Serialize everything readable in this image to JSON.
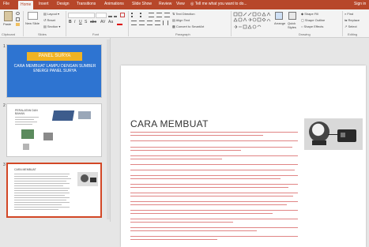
{
  "tabs": [
    "File",
    "Home",
    "Insert",
    "Design",
    "Transitions",
    "Animations",
    "Slide Show",
    "Review",
    "View",
    "Tell me what you want to do..."
  ],
  "user": "Sign in",
  "ribbon": {
    "clipboard": {
      "paste": "Paste",
      "group": "Clipboard"
    },
    "slides": {
      "new_slide": "New Slide",
      "layout": "Layout",
      "reset": "Reset",
      "section": "Section",
      "group": "Slides"
    },
    "font": {
      "group": "Font"
    },
    "paragraph": {
      "text_direction": "Text Direction",
      "align_text": "Align Text",
      "smartart": "Convert to SmartArt",
      "group": "Paragraph"
    },
    "drawing": {
      "arrange": "Arrange",
      "quick_styles": "Quick Styles",
      "shape_fill": "Shape Fill",
      "shape_outline": "Shape Outline",
      "shape_effects": "Shape Effects",
      "group": "Drawing"
    },
    "editing": {
      "find": "Find",
      "replace": "Replace",
      "select": "Select",
      "group": "Editing"
    }
  },
  "thumbs": [
    {
      "num": "1",
      "header": "PANEL SURYA",
      "title": "CARA MEMBUAT LAMPU DENGAN SUMBER ENERGI PANEL SURYA"
    },
    {
      "num": "2",
      "title": "PERALATAN DAN BAHAN"
    },
    {
      "num": "3",
      "title": "CARA MEMBUAT"
    }
  ],
  "slide": {
    "title": "CARA MEMBUAT"
  },
  "colors": {
    "accent": "#b7472a",
    "selection": "#d24726",
    "slide1_bg": "#2e74d1",
    "slide1_banner": "#f0b323"
  }
}
